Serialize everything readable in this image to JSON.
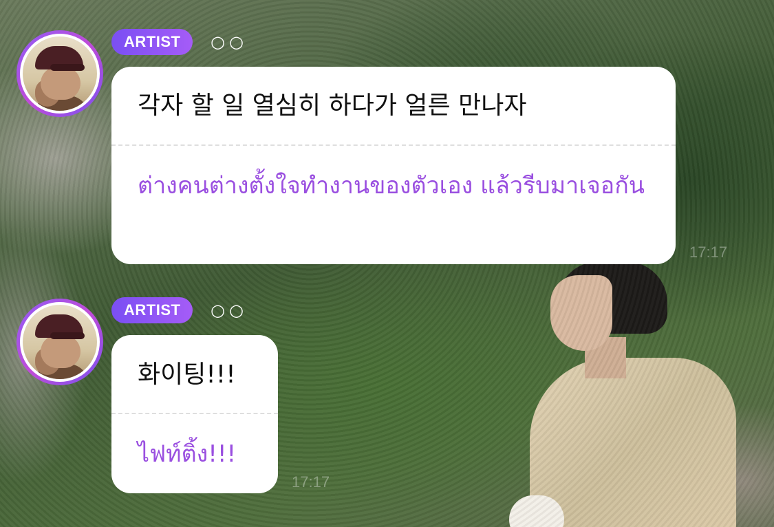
{
  "messages": [
    {
      "badge": "ARTIST",
      "status": "○○",
      "original": "각자 할 일 열심히 하다가 얼른 만나자",
      "translation": "ต่างคนต่างตั้งใจทำงานของตัวเอง แล้วรีบมาเจอกัน",
      "time": "17:17"
    },
    {
      "badge": "ARTIST",
      "status": "○○",
      "original": "화이팅!!!",
      "translation": "ไฟท์ติ้ง!!!",
      "time": "17:17"
    }
  ],
  "colors": {
    "badge": "#8a55f5",
    "translation_text": "#9a4fe0",
    "bubble": "#ffffff"
  }
}
